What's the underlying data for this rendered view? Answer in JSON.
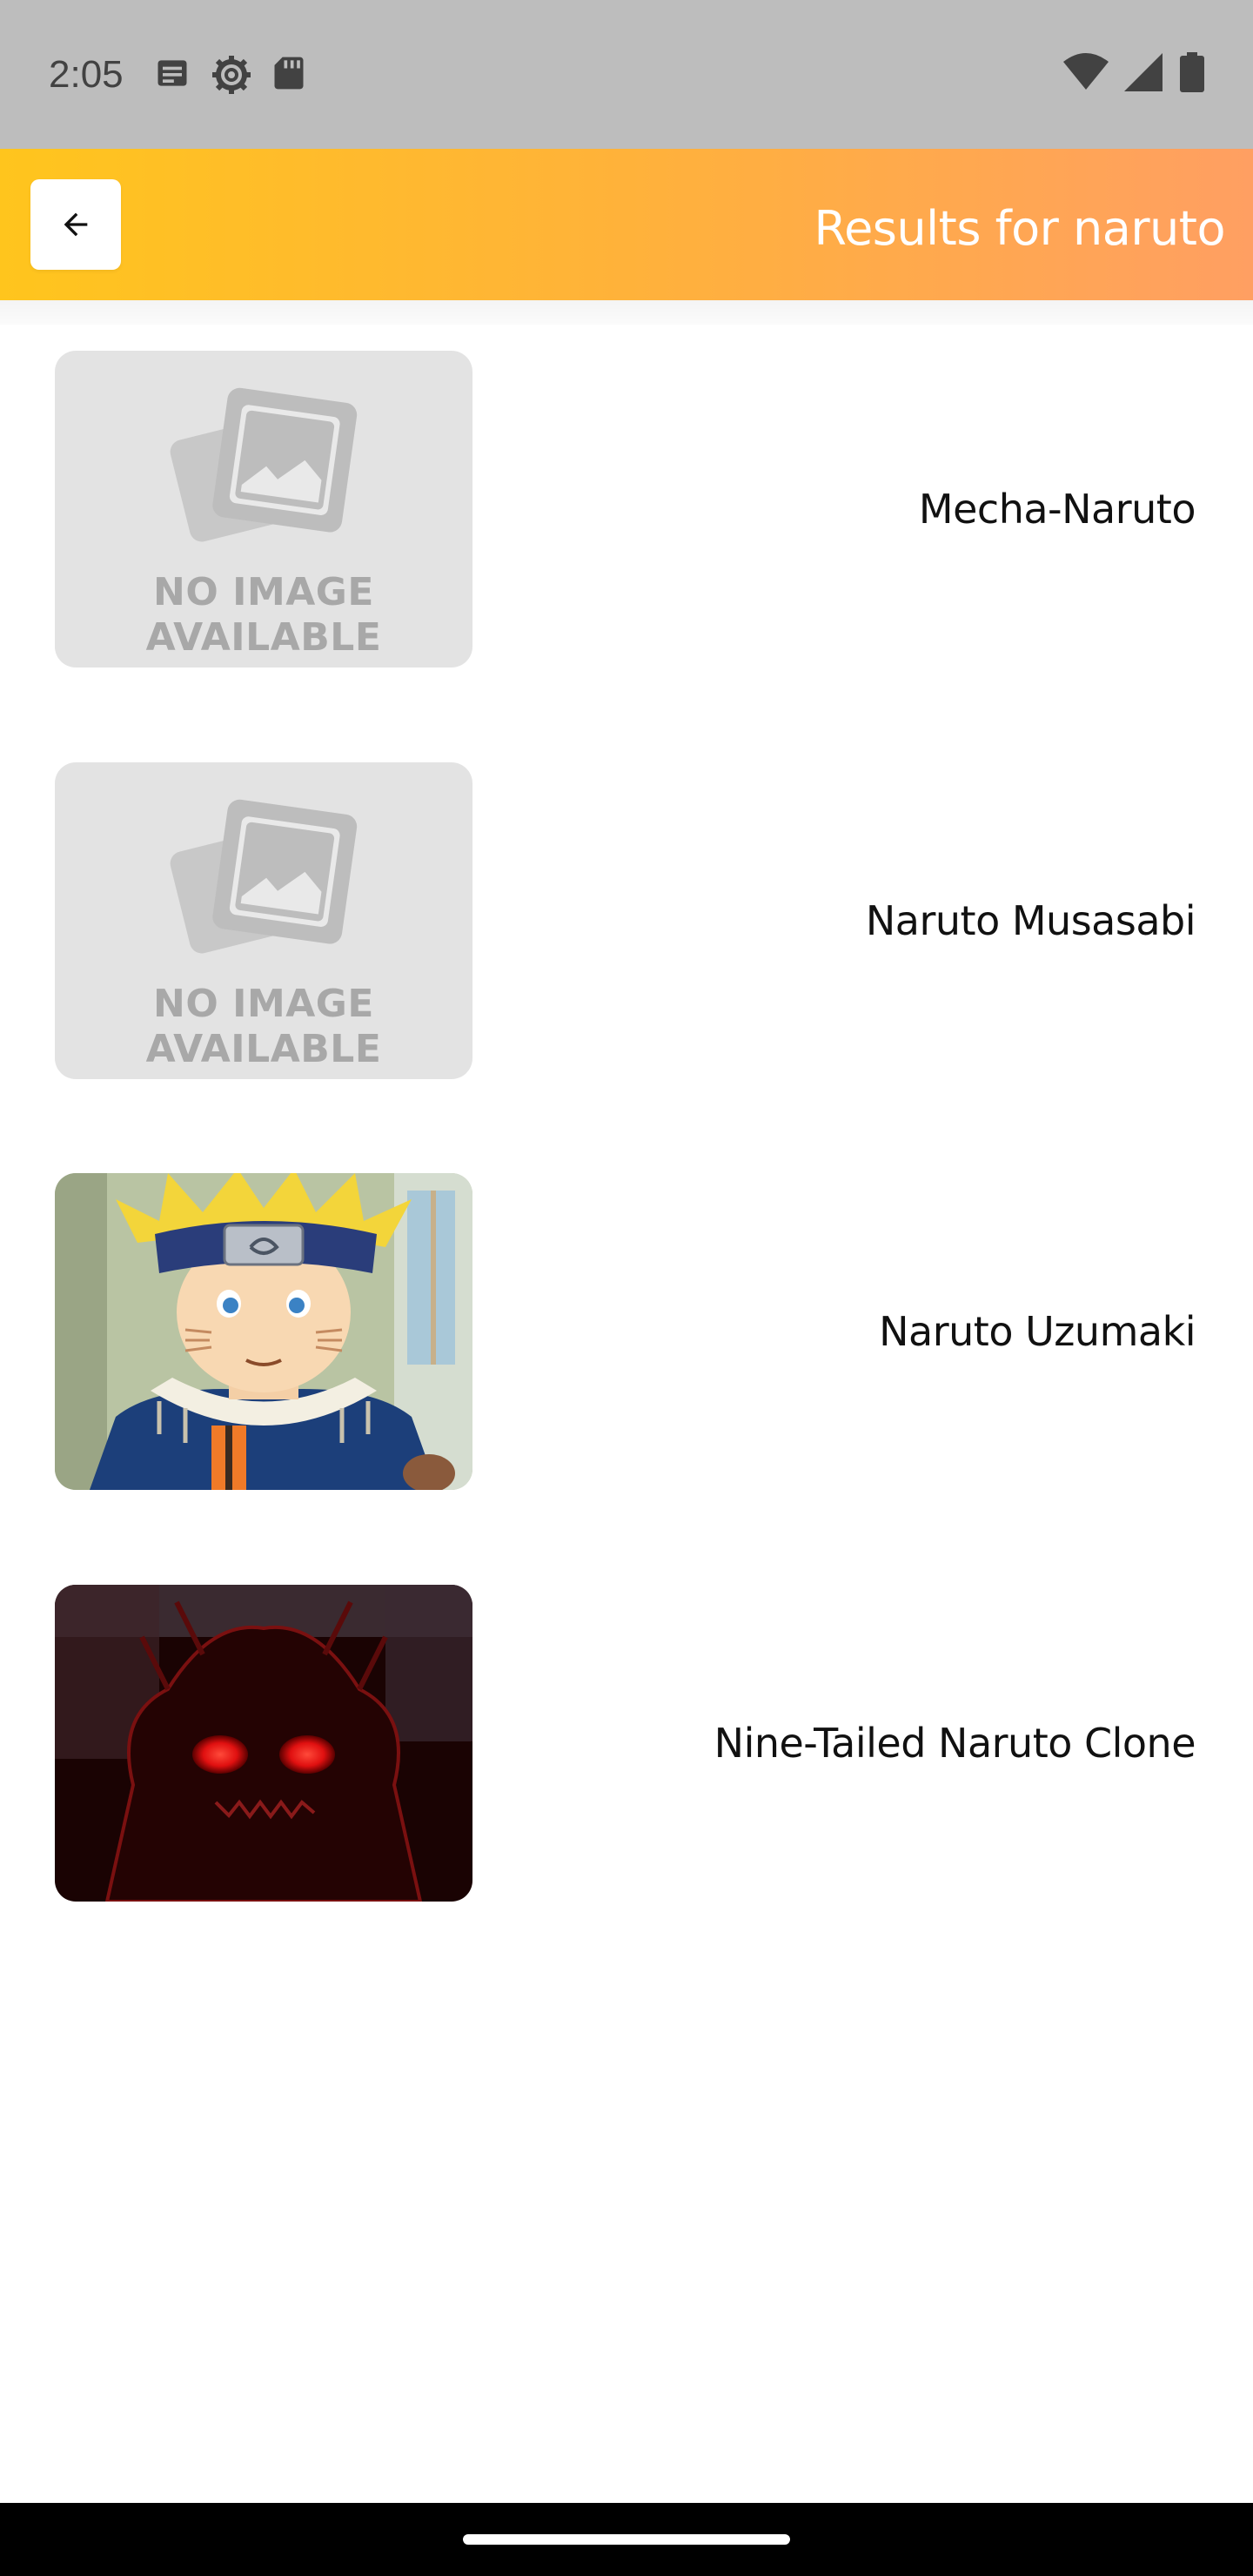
{
  "status_bar": {
    "time": "2:05",
    "left_icons": [
      "notification-doc-icon",
      "settings-gear-icon",
      "sd-card-icon"
    ],
    "right_icons": [
      "wifi-icon",
      "cell-signal-icon",
      "battery-icon"
    ]
  },
  "app_bar": {
    "back_icon": "arrow-left-icon",
    "title": "Results for naruto",
    "gradient": [
      "#ffc51d",
      "#ff9f62"
    ]
  },
  "placeholder": {
    "line1": "NO IMAGE",
    "line2": "AVAILABLE"
  },
  "results": [
    {
      "name": "Mecha-Naruto",
      "image": "no-image"
    },
    {
      "name": "Naruto Musasabi",
      "image": "no-image"
    },
    {
      "name": "Naruto Uzumaki",
      "image": "naruto-portrait"
    },
    {
      "name": "Nine-Tailed Naruto Clone",
      "image": "nine-tails-silhouette"
    }
  ]
}
